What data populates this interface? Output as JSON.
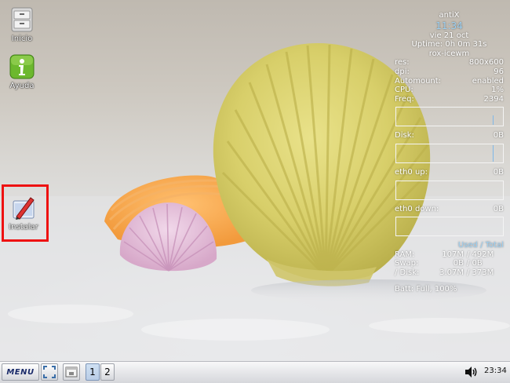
{
  "desktop": {
    "icons": [
      {
        "label": "Inicio",
        "icon": "drawer-home-icon"
      },
      {
        "label": "Ayuda",
        "icon": "info-help-icon"
      },
      {
        "label": "Instalar",
        "icon": "install-pencil-icon"
      }
    ]
  },
  "conky": {
    "hostname": "antiX",
    "time": "11:34",
    "date": "vie 21 oct",
    "uptime": "Uptime: 0h 0m 31s",
    "session": "rox-icewm",
    "stats": [
      {
        "label": "res:",
        "value": "800x600"
      },
      {
        "label": "dpi:",
        "value": "96"
      },
      {
        "label": "Automount:",
        "value": "enabled"
      },
      {
        "label": "CPU:",
        "value": "1%"
      },
      {
        "label": "Freq:",
        "value": "2394"
      }
    ],
    "disk": {
      "label": "Disk:",
      "value": "0B"
    },
    "eth0_up": {
      "label": "eth0 up:",
      "value": "0B"
    },
    "eth0_down": {
      "label": "eth0 down:",
      "value": "0B"
    },
    "used_total_header": "Used / Total",
    "memory": [
      {
        "label": "RAM:",
        "used": "107M",
        "total": "/ 492M"
      },
      {
        "label": "Swap:",
        "used": "0B",
        "total": "/ 0B"
      },
      {
        "label": "/ Disk:",
        "used": "3.07M",
        "total": "/ 373M"
      }
    ],
    "battery": "Batt: Full, 100%",
    "accent_color": "#9cd0f2"
  },
  "taskbar": {
    "menu_label": "MENU",
    "workspaces": [
      "1",
      "2"
    ],
    "active_workspace": "1",
    "clock": "23:34",
    "icons": [
      "fullscreen-icon",
      "show-desktop-icon",
      "volume-icon"
    ]
  },
  "highlight_color": "#ee1111"
}
